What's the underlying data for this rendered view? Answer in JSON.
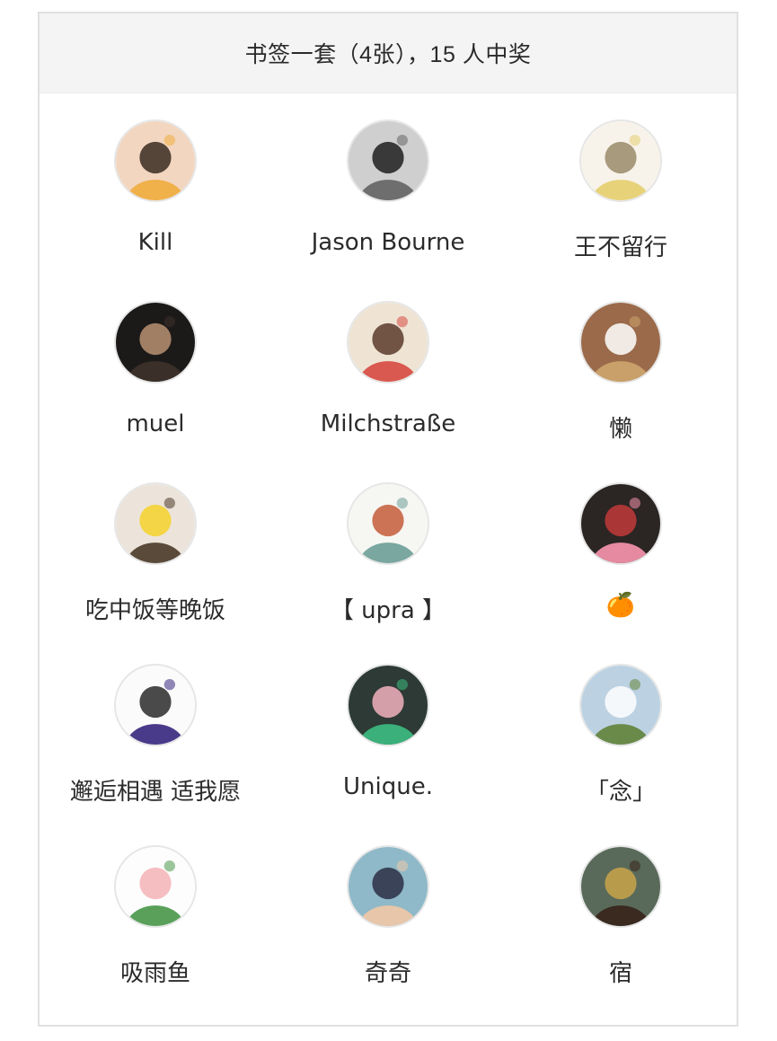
{
  "prize": {
    "title": "书签一套（4张），15 人中奖"
  },
  "winners": [
    {
      "name": "Kill",
      "avatar": "child-eating-avatar",
      "bg": "#f2d6c0",
      "fg": "#3a2a20",
      "accent": "#f0b04a"
    },
    {
      "name": "Jason Bourne",
      "avatar": "bw-man-portrait-avatar",
      "bg": "#cfcfcf",
      "fg": "#1f1f1f",
      "accent": "#6e6e6e"
    },
    {
      "name": "王不留行",
      "avatar": "couple-bicycle-sketch-avatar",
      "bg": "#f7f3ea",
      "fg": "#9a8a6a",
      "accent": "#e7d27a"
    },
    {
      "name": "muel",
      "avatar": "man-dark-portrait-avatar",
      "bg": "#1c1a19",
      "fg": "#b89272",
      "accent": "#3a2f29"
    },
    {
      "name": "Milchstraße",
      "avatar": "girl-flower-painting-avatar",
      "bg": "#efe4d4",
      "fg": "#5a3b2a",
      "accent": "#d9584f"
    },
    {
      "name": "懒",
      "avatar": "polar-bear-reading-avatar",
      "bg": "#9a6a4a",
      "fg": "#ffffff",
      "accent": "#c9a06a"
    },
    {
      "name": "吃中饭等晚饭",
      "avatar": "yellow-pikachu-sketch-avatar",
      "bg": "#ece4da",
      "fg": "#f4d22a",
      "accent": "#5a4a3a"
    },
    {
      "name": "【 upra 】",
      "avatar": "sitting-figure-illustration-avatar",
      "bg": "#f6f6f2",
      "fg": "#c45a3a",
      "accent": "#7aa7a0"
    },
    {
      "name": "🍊",
      "avatar": "woman-red-sweater-avatar",
      "bg": "#2b2524",
      "fg": "#c23a3a",
      "accent": "#e58aa0"
    },
    {
      "name": "邂逅相遇 适我愿",
      "avatar": "umbrella-penguin-cartoon-avatar",
      "bg": "#fbfbfb",
      "fg": "#2a2a2a",
      "accent": "#4a3a8a"
    },
    {
      "name": "Unique.",
      "avatar": "pink-hair-anime-girl-avatar",
      "bg": "#2d3a35",
      "fg": "#f2b2bc",
      "accent": "#3bb07a"
    },
    {
      "name": "「念」",
      "avatar": "girl-hugging-bear-avatar",
      "bg": "#bcd2e2",
      "fg": "#ffffff",
      "accent": "#6a8a4a"
    },
    {
      "name": "吸雨鱼",
      "avatar": "pink-pig-sketch-avatar",
      "bg": "#fdfdfd",
      "fg": "#f3b3b6",
      "accent": "#5aa05a"
    },
    {
      "name": "奇奇",
      "avatar": "anime-boy-cap-avatar",
      "bg": "#8fb9c8",
      "fg": "#2c2e44",
      "accent": "#e7c6aa"
    },
    {
      "name": "宿",
      "avatar": "street-photo-avatar",
      "bg": "#5a6a5a",
      "fg": "#c9a44a",
      "accent": "#3a2a20"
    }
  ]
}
